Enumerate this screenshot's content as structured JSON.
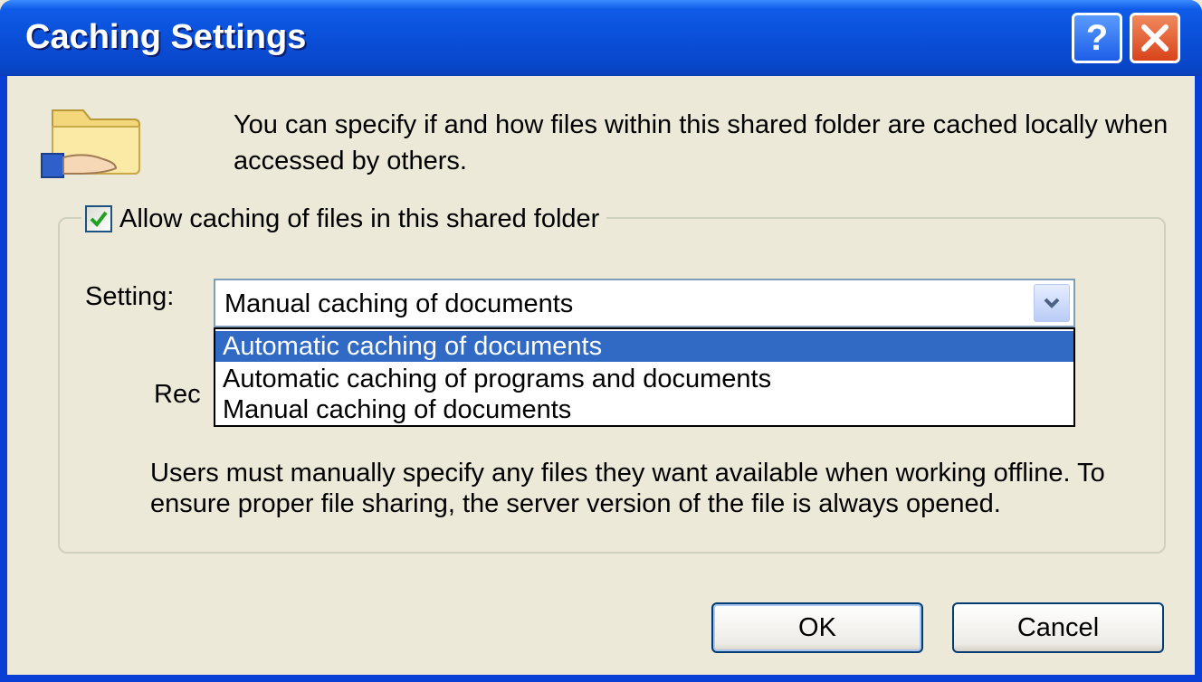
{
  "window": {
    "title": "Caching Settings"
  },
  "titlebar": {
    "help_label": "?",
    "help_icon": "help-icon",
    "close_icon": "close-icon"
  },
  "description": "You can specify if and how files within this shared folder are cached locally when accessed by others.",
  "allow_caching": {
    "label": "Allow caching of files in this shared folder",
    "checked": true
  },
  "setting": {
    "label": "Setting:",
    "value": "Manual caching of documents",
    "options": [
      "Automatic caching of documents",
      "Automatic caching of programs and documents",
      "Manual caching of documents"
    ],
    "highlighted_index": 0
  },
  "recommend_partial": "Rec",
  "info": "Users must manually specify any files they want available when working offline.  To ensure proper file sharing, the server version of the file is always opened.",
  "buttons": {
    "ok": "OK",
    "cancel": "Cancel"
  },
  "colors": {
    "titlebar": "#0a4fd8",
    "selection": "#316ac5",
    "dialog_bg": "#ece9d8"
  }
}
